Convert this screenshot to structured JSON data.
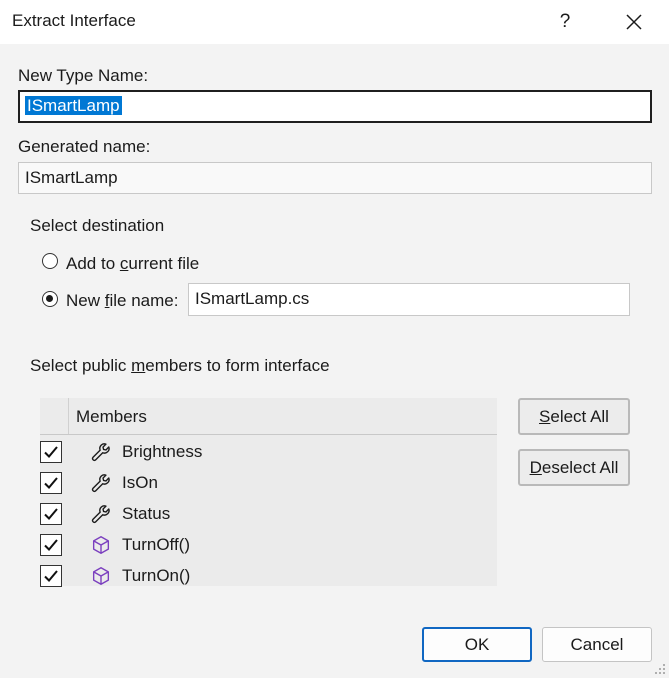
{
  "title": "Extract Interface",
  "title_buttons": {
    "help": "?"
  },
  "new_type_name": {
    "label": "New Type Name:",
    "value": "ISmartLamp"
  },
  "generated_name": {
    "label": "Generated name:",
    "value": "ISmartLamp"
  },
  "destination": {
    "heading_prefix": "Select ",
    "heading_suffix": "destination",
    "add_prefix": "Add to ",
    "add_underlined": "c",
    "add_suffix": "urrent file",
    "new_prefix": "New ",
    "new_underlined": "f",
    "new_suffix": "ile name:",
    "file_name_value": "ISmartLamp.cs",
    "selected": "new-file"
  },
  "members": {
    "heading_prefix": "Select public ",
    "heading_underlined": "m",
    "heading_suffix": "embers to form interface",
    "column_header": "Members",
    "items": [
      {
        "label": "Brightness",
        "icon": "wrench-icon",
        "checked": true
      },
      {
        "label": "IsOn",
        "icon": "wrench-icon",
        "checked": true
      },
      {
        "label": "Status",
        "icon": "wrench-icon",
        "checked": true
      },
      {
        "label": "TurnOff()",
        "icon": "method-cube-icon",
        "checked": true
      },
      {
        "label": "TurnOn()",
        "icon": "method-cube-icon",
        "checked": true
      }
    ]
  },
  "buttons": {
    "select_all_underlined": "S",
    "select_all_rest": "elect All",
    "deselect_all_underlined": "D",
    "deselect_all_rest": "eselect All",
    "ok": "OK",
    "cancel": "Cancel"
  },
  "colors": {
    "accent": "#0078d4",
    "method_icon": "#7b3fbf"
  }
}
